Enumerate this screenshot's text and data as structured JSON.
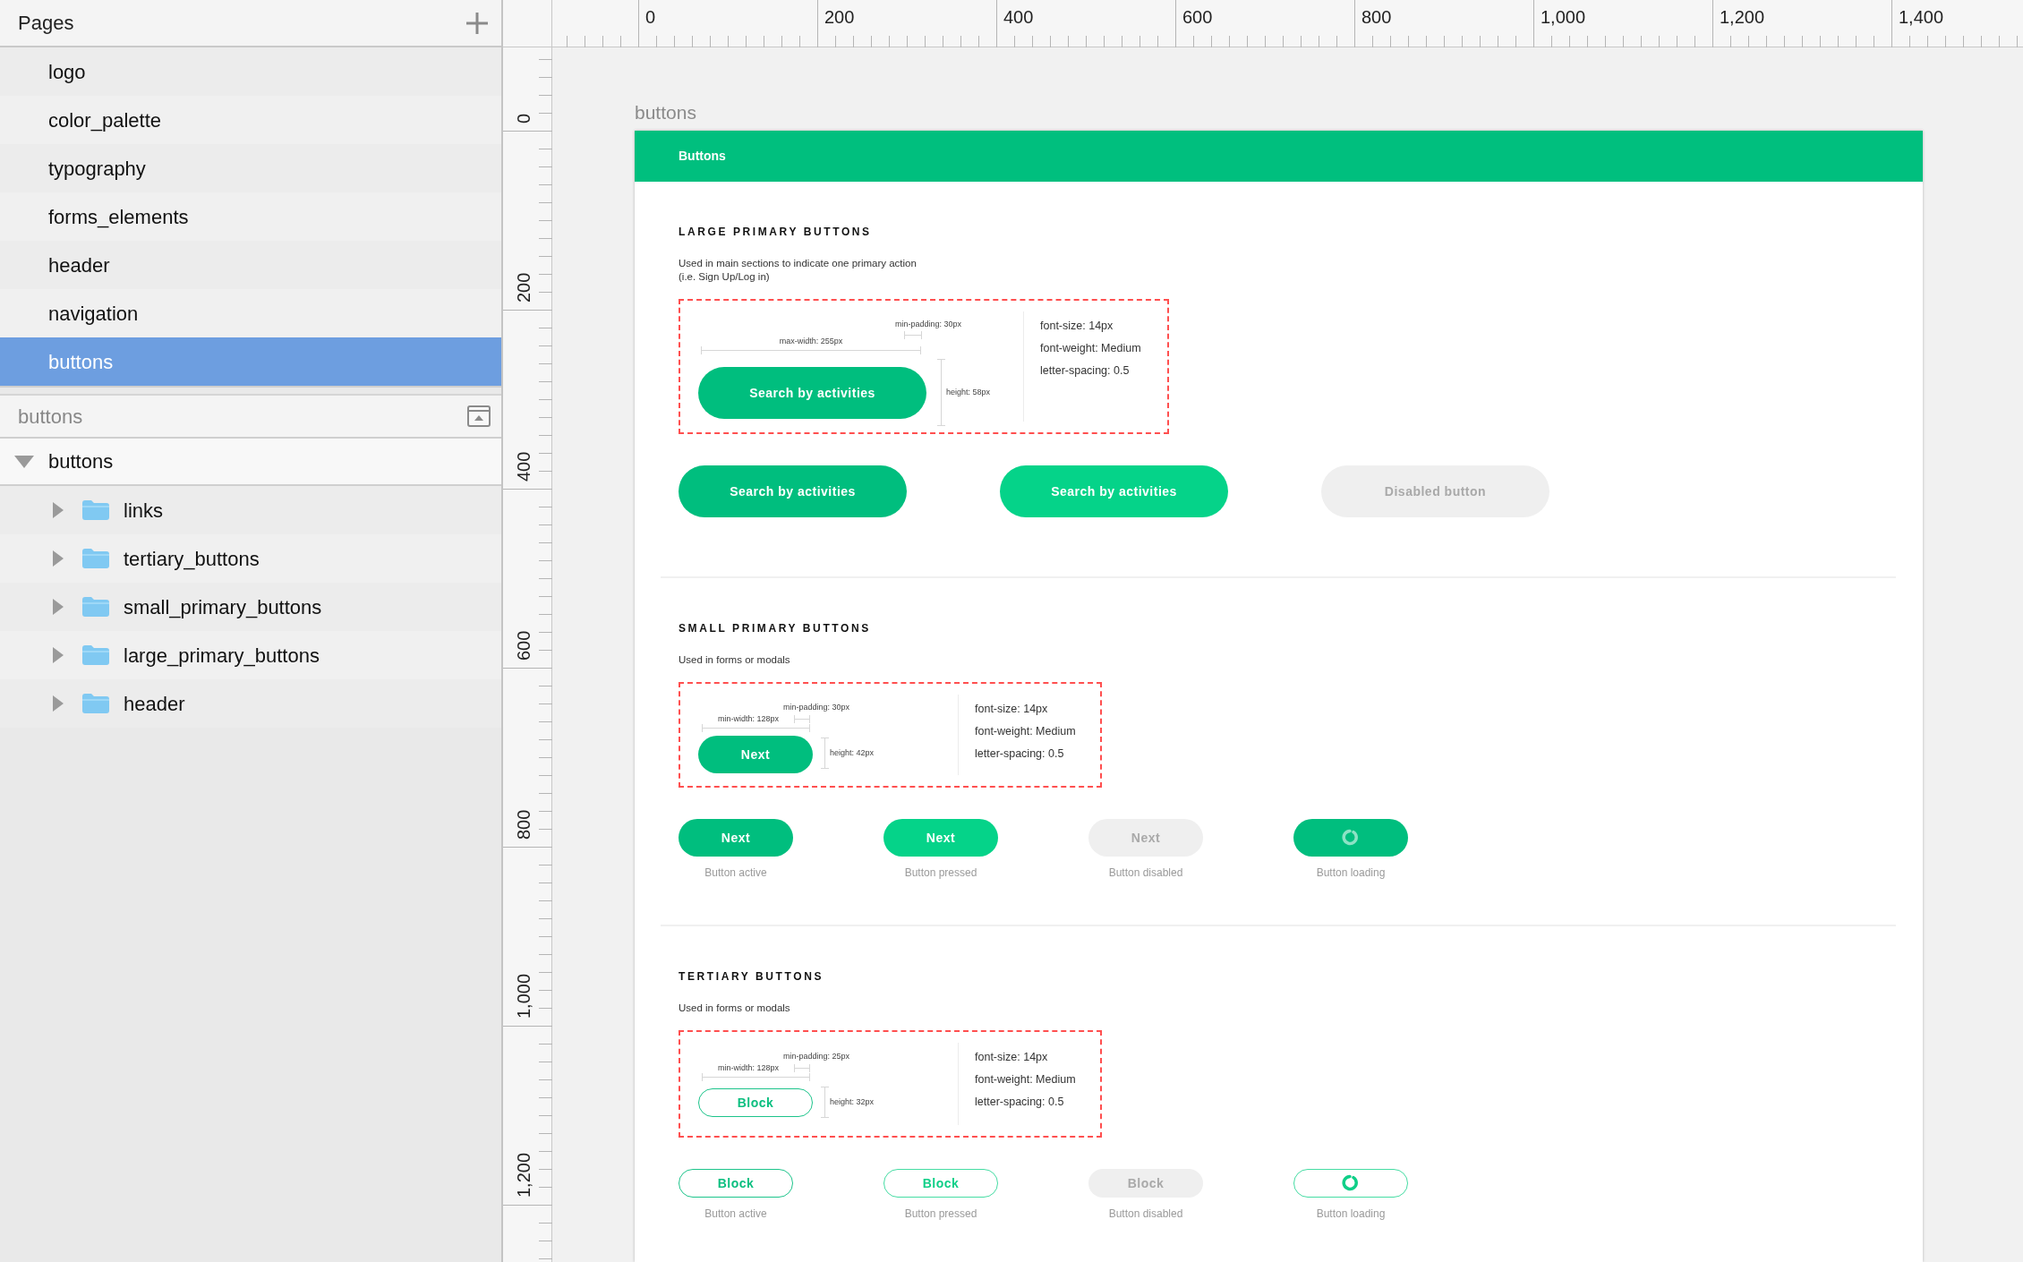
{
  "pages_panel": {
    "title": "Pages",
    "items": [
      {
        "label": "logo",
        "selected": false
      },
      {
        "label": "color_palette",
        "selected": false
      },
      {
        "label": "typography",
        "selected": false
      },
      {
        "label": "forms_elements",
        "selected": false
      },
      {
        "label": "header",
        "selected": false
      },
      {
        "label": "navigation",
        "selected": false
      },
      {
        "label": "buttons",
        "selected": true
      }
    ]
  },
  "layers_panel": {
    "title": "buttons",
    "root": {
      "label": "buttons",
      "expanded": true,
      "children": [
        {
          "label": "links",
          "expanded": false
        },
        {
          "label": "tertiary_buttons",
          "expanded": false
        },
        {
          "label": "small_primary_buttons",
          "expanded": false
        },
        {
          "label": "large_primary_buttons",
          "expanded": false
        },
        {
          "label": "header",
          "expanded": false
        }
      ]
    }
  },
  "rulers": {
    "horizontal": [
      "0",
      "200",
      "400",
      "600",
      "800",
      "1,000",
      "1,200",
      "1,400"
    ],
    "vertical": [
      "0",
      "200",
      "400",
      "600",
      "800",
      "1,000",
      "1,200"
    ]
  },
  "artboard": {
    "title": "buttons",
    "header": "Buttons",
    "sections": [
      {
        "kind": "large",
        "title": "LARGE PRIMARY BUTTONS",
        "description": [
          "Used in main sections to indicate one primary action",
          "(i.e. Sign Up/Log in)"
        ],
        "spec": {
          "button": "Search by activities",
          "width_note": "max-width: 255px",
          "padding_note": "min-padding: 30px",
          "height_note": "height: 58px",
          "properties": [
            "font-size: 14px",
            "font-weight: Medium",
            "letter-spacing: 0.5"
          ]
        },
        "examples": [
          {
            "kind": "active",
            "label": "Search by activities"
          },
          {
            "kind": "pressed",
            "label": "Search by activities"
          },
          {
            "kind": "disabled",
            "label": "Disabled button"
          }
        ]
      },
      {
        "kind": "small",
        "title": "SMALL PRIMARY BUTTONS",
        "description": [
          "Used in forms or modals"
        ],
        "spec": {
          "button": "Next",
          "width_note": "min-width: 128px",
          "padding_note": "min-padding: 30px",
          "height_note": "height: 42px",
          "properties": [
            "font-size: 14px",
            "font-weight: Medium",
            "letter-spacing: 0.5"
          ]
        },
        "examples": [
          {
            "kind": "active",
            "label": "Next",
            "caption": "Button active"
          },
          {
            "kind": "pressed",
            "label": "Next",
            "caption": "Button pressed"
          },
          {
            "kind": "disabled",
            "label": "Next",
            "caption": "Button disabled"
          },
          {
            "kind": "loading",
            "caption": "Button loading"
          }
        ]
      },
      {
        "kind": "tertiary",
        "title": "TERTIARY BUTTONS",
        "description": [
          "Used in forms or modals"
        ],
        "spec": {
          "button": "Block",
          "width_note": "min-width: 128px",
          "padding_note": "min-padding: 25px",
          "height_note": "height: 32px",
          "properties": [
            "font-size: 14px",
            "font-weight: Medium",
            "letter-spacing: 0.5"
          ]
        },
        "examples": [
          {
            "kind": "active",
            "label": "Block",
            "caption": "Button active"
          },
          {
            "kind": "pressed",
            "label": "Block",
            "caption": "Button pressed"
          },
          {
            "kind": "disabled",
            "label": "Block",
            "caption": "Button disabled"
          },
          {
            "kind": "loading",
            "caption": "Button loading"
          }
        ]
      }
    ]
  }
}
